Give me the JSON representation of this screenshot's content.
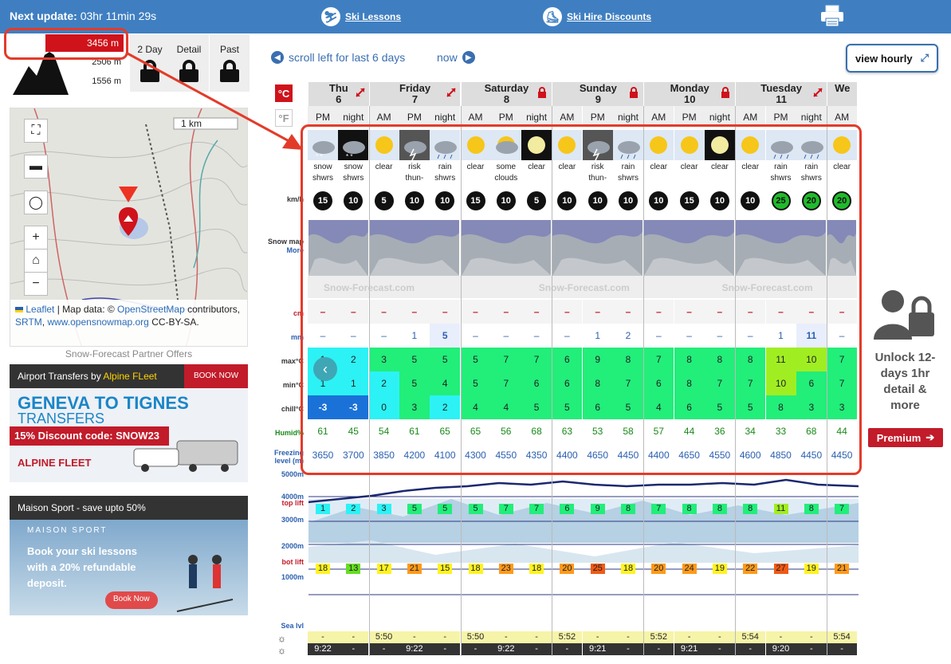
{
  "topbar": {
    "next_update_label": "Next update:",
    "next_update_value": "03hr 11min 29s",
    "ski_lessons": "Ski Lessons",
    "ski_hire": "Ski Hire Discounts"
  },
  "elevation": {
    "top": "3456 m",
    "mid": "2506 m",
    "bot": "1556 m",
    "tabs": [
      "2 Day",
      "Detail",
      "Past"
    ]
  },
  "map": {
    "scale": "1 km",
    "attribution_prefix": "Leaflet",
    "attribution_mid": " | Map data: © ",
    "osm": "OpenStreetMap",
    "contributors": " contributors, ",
    "srtm": "SRTM",
    "comma": ", ",
    "osm_snow": "www.opensnowmap.org",
    "suffix": " CC-BY-SA."
  },
  "partners": {
    "title": "Snow-Forecast Partner Offers",
    "ad1_head": "Airport Transfers by ",
    "ad1_brand": "Alpine FLeet",
    "ad1_book": "BOOK NOW",
    "ad1_line1": "GENEVA TO TIGNES",
    "ad1_line2": "TRANSFERS",
    "ad1_discount": "15% Discount code: SNOW23",
    "ad1_logo": "ALPINE FLEET",
    "ad2_head": "Maison Sport - save upto 50%",
    "ad2_logo": "MAISON SPORT",
    "ad2_text": "Book your ski lessons with a 20% refundable deposit.",
    "ad2_btn": "Book Now"
  },
  "nav": {
    "scroll_left": "scroll left for last 6 days",
    "now": "now",
    "view_hourly": "view hourly",
    "unit_c": "°C",
    "unit_f": "°F"
  },
  "row_labels": {
    "wind": "km/h",
    "snowmap": "Snow map",
    "more": "More",
    "snow": "cm",
    "rain": "mm",
    "max": "max°C",
    "min": "min°C",
    "chill": "chill°C",
    "humid": "Humid%",
    "freezing": "Freezing level (m)",
    "top_lift": "top lift",
    "bot_lift": "bot lift",
    "sea": "Sea lvl",
    "alt5000": "5000m",
    "alt4000": "4000m",
    "alt3000": "3000m",
    "alt2000": "2000m",
    "alt1000": "1000m"
  },
  "brand": "Snow-Forecast.com",
  "days": [
    {
      "name": "Thu",
      "date": "6"
    },
    {
      "name": "Friday",
      "date": "7"
    },
    {
      "name": "Saturday",
      "date": "8"
    },
    {
      "name": "Sunday",
      "date": "9"
    },
    {
      "name": "Monday",
      "date": "10"
    },
    {
      "name": "Tuesday",
      "date": "11"
    },
    {
      "name": "We",
      "date": ""
    }
  ],
  "periods": [
    "PM",
    "night",
    "AM",
    "PM",
    "night",
    "AM",
    "PM",
    "night",
    "AM",
    "PM",
    "night",
    "AM",
    "PM",
    "night",
    "AM",
    "PM",
    "night",
    "AM"
  ],
  "weather": [
    "snow shwrs",
    "snow shwrs",
    "clear",
    "risk thun-",
    "rain shwrs",
    "clear",
    "some clouds",
    "clear",
    "clear",
    "risk thun-",
    "rain shwrs",
    "clear",
    "clear",
    "clear",
    "clear",
    "rain shwrs",
    "rain shwrs",
    "clear"
  ],
  "weather_icon": [
    "snow",
    "snow-night",
    "sun",
    "storm",
    "rain",
    "sun",
    "cloud-sun",
    "moon",
    "sun",
    "storm",
    "rain",
    "sun",
    "sun",
    "moon",
    "sun",
    "rain",
    "rain",
    "sun"
  ],
  "wind": [
    "15",
    "10",
    "5",
    "10",
    "10",
    "15",
    "10",
    "5",
    "10",
    "10",
    "10",
    "10",
    "15",
    "10",
    "10",
    "25",
    "20",
    "20"
  ],
  "wind_green": [
    false,
    false,
    false,
    false,
    false,
    false,
    false,
    false,
    false,
    false,
    false,
    false,
    false,
    false,
    false,
    true,
    true,
    true
  ],
  "snow": [
    "–",
    "–",
    "–",
    "–",
    "–",
    "–",
    "–",
    "–",
    "–",
    "–",
    "–",
    "–",
    "–",
    "–",
    "–",
    "–",
    "–",
    "–"
  ],
  "rain": [
    "–",
    "–",
    "–",
    "1",
    "5",
    "–",
    "–",
    "–",
    "–",
    "1",
    "2",
    "–",
    "–",
    "–",
    "–",
    "1",
    "11",
    "–"
  ],
  "max": [
    "1",
    "2",
    "3",
    "5",
    "5",
    "5",
    "7",
    "7",
    "6",
    "9",
    "8",
    "7",
    "8",
    "8",
    "8",
    "11",
    "10",
    "7"
  ],
  "min": [
    "1",
    "1",
    "2",
    "5",
    "4",
    "5",
    "7",
    "6",
    "6",
    "8",
    "7",
    "6",
    "8",
    "7",
    "7",
    "10",
    "6",
    "7"
  ],
  "chill": [
    "-3",
    "-3",
    "0",
    "3",
    "2",
    "4",
    "4",
    "5",
    "5",
    "6",
    "5",
    "4",
    "6",
    "5",
    "5",
    "8",
    "3",
    "3"
  ],
  "humid": [
    "61",
    "45",
    "54",
    "61",
    "65",
    "65",
    "56",
    "68",
    "63",
    "53",
    "58",
    "57",
    "44",
    "36",
    "34",
    "33",
    "68",
    "44"
  ],
  "freezing": [
    "3650",
    "3700",
    "3850",
    "4200",
    "4100",
    "4300",
    "4550",
    "4350",
    "4400",
    "4650",
    "4450",
    "4400",
    "4650",
    "4550",
    "4600",
    "4850",
    "4450",
    "4450"
  ],
  "top_lift": [
    "1",
    "2",
    "3",
    "5",
    "5",
    "5",
    "7",
    "7",
    "6",
    "9",
    "8",
    "7",
    "8",
    "8",
    "8",
    "11",
    "8",
    "7"
  ],
  "bot_lift": [
    "18",
    "13",
    "17",
    "21",
    "15",
    "18",
    "23",
    "18",
    "20",
    "25",
    "18",
    "20",
    "24",
    "19",
    "22",
    "27",
    "19",
    "21"
  ],
  "sunrise": [
    "-",
    "-",
    "5:50",
    "-",
    "-",
    "5:50",
    "-",
    "-",
    "5:52",
    "-",
    "-",
    "5:52",
    "-",
    "-",
    "5:54",
    "-",
    "-",
    "5:54"
  ],
  "sunset": [
    "9:22",
    "-",
    "-",
    "9:22",
    "-",
    "-",
    "9:22",
    "-",
    "-",
    "9:21",
    "-",
    "-",
    "9:21",
    "-",
    "-",
    "9:20",
    "-",
    "-"
  ],
  "unlock": {
    "text": "Unlock 12-days 1hr detail & more",
    "premium": "Premium"
  },
  "colors": {
    "topbar": "#3f7fc1",
    "red": "#d0121b",
    "green": "#22ee7a",
    "cyan": "#2cf2f5",
    "blue": "#1a72d8",
    "yellow_green": "#a0ee22"
  }
}
